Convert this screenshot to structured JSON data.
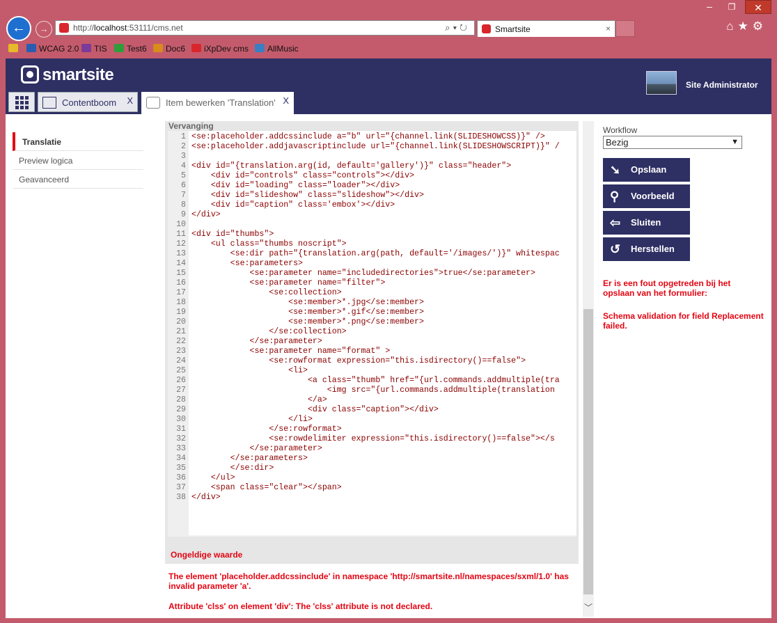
{
  "browser": {
    "address_prefix": "http://",
    "address_host": "localhost",
    "address_rest": ":53111/cms.net",
    "tab_title": "Smartsite",
    "tab_close": "×",
    "favorites": [
      {
        "label": "WCAG 2.0",
        "icon": "w3c-icon",
        "color": "#2a5db0"
      },
      {
        "label": "TIS",
        "icon": "tis-icon",
        "color": "#7a3b99"
      },
      {
        "label": "Test6",
        "icon": "check-icon",
        "color": "#2e9d3a"
      },
      {
        "label": "Doc6",
        "icon": "doc-icon",
        "color": "#d98b1b"
      },
      {
        "label": "iXpDev cms",
        "icon": "smartsite-icon",
        "color": "#d9262c"
      },
      {
        "label": "AllMusic",
        "icon": "allmusic-icon",
        "color": "#3a7fc4"
      }
    ]
  },
  "app": {
    "logo_text": "smartsite",
    "user_name": "Site Administrator",
    "tabs": [
      {
        "label": "Contentboom",
        "close": "X"
      },
      {
        "label": "Item bewerken 'Translation'",
        "close": "X"
      }
    ]
  },
  "leftnav": {
    "items": [
      "Translatie",
      "Preview logica",
      "Geavanceerd"
    ]
  },
  "editor": {
    "label": "Vervanging",
    "invalid_label": "Ongeldige waarde",
    "lines": [
      {
        "n": "1",
        "text": "<se:placeholder.addcssinclude a=\"b\" url=\"{channel.link(SLIDESHOWCSS)}\" />"
      },
      {
        "n": "2",
        "text": "<se:placeholder.addjavascriptinclude url=\"{channel.link(SLIDESHOWSCRIPT)}\" /"
      },
      {
        "n": "3",
        "text": ""
      },
      {
        "n": "4",
        "text": "<div id=\"{translation.arg(id, default='gallery')}\" class=\"header\">"
      },
      {
        "n": "5",
        "text": "    <div id=\"controls\" class=\"controls\"></div>"
      },
      {
        "n": "6",
        "text": "    <div id=\"loading\" class=\"loader\"></div>"
      },
      {
        "n": "7",
        "text": "    <div id=\"slideshow\" class=\"slideshow\"></div>"
      },
      {
        "n": "8",
        "text": "    <div id=\"caption\" class='embox'></div>"
      },
      {
        "n": "9",
        "text": "</div>"
      },
      {
        "n": "10",
        "text": ""
      },
      {
        "n": "11",
        "text": "<div id=\"thumbs\">"
      },
      {
        "n": "12",
        "text": "    <ul class=\"thumbs noscript\">"
      },
      {
        "n": "13",
        "text": "        <se:dir path=\"{translation.arg(path, default='/images/')}\" whitespac"
      },
      {
        "n": "14",
        "text": "        <se:parameters>"
      },
      {
        "n": "15",
        "text": "            <se:parameter name=\"includedirectories\">true</se:parameter>"
      },
      {
        "n": "16",
        "text": "            <se:parameter name=\"filter\">"
      },
      {
        "n": "17",
        "text": "                <se:collection>"
      },
      {
        "n": "18",
        "text": "                    <se:member>*.jpg</se:member>"
      },
      {
        "n": "19",
        "text": "                    <se:member>*.gif</se:member>"
      },
      {
        "n": "20",
        "text": "                    <se:member>*.png</se:member>"
      },
      {
        "n": "21",
        "text": "                </se:collection>"
      },
      {
        "n": "22",
        "text": "            </se:parameter>"
      },
      {
        "n": "23",
        "text": "            <se:parameter name=\"format\" >"
      },
      {
        "n": "24",
        "text": "                <se:rowformat expression=\"this.isdirectory()==false\">"
      },
      {
        "n": "25",
        "text": "                    <li>"
      },
      {
        "n": "26",
        "text": "                        <a class=\"thumb\" href=\"{url.commands.addmultiple(tra"
      },
      {
        "n": "27",
        "text": "                            <img src=\"{url.commands.addmultiple(translation"
      },
      {
        "n": "28",
        "text": "                        </a>"
      },
      {
        "n": "29",
        "text": "                        <div class=\"caption\"></div>"
      },
      {
        "n": "30",
        "text": "                    </li>"
      },
      {
        "n": "31",
        "text": "                </se:rowformat>"
      },
      {
        "n": "32",
        "text": "                <se:rowdelimiter expression=\"this.isdirectory()==false\"></s"
      },
      {
        "n": "33",
        "text": "            </se:parameter>"
      },
      {
        "n": "34",
        "text": "        </se:parameters>"
      },
      {
        "n": "35",
        "text": "        </se:dir>"
      },
      {
        "n": "36",
        "text": "    </ul>"
      },
      {
        "n": "37",
        "text": "    <span class=\"clear\"></span>"
      },
      {
        "n": "38",
        "text": "</div>"
      }
    ]
  },
  "errors": {
    "error1_line1": "The element 'placeholder.addcssinclude' in namespace 'http://smartsite.nl/namespaces/sxml/1.0' has",
    "error1_line2": "invalid parameter 'a'.",
    "error2": "Attribute 'clss' on element 'div': The 'clss' attribute is not declared."
  },
  "sidebar": {
    "workflow_label": "Workflow",
    "workflow_value": "Bezig",
    "buttons": [
      {
        "label": "Opslaan",
        "icon": "save-arrow-icon"
      },
      {
        "label": "Voorbeeld",
        "icon": "search-icon"
      },
      {
        "label": "Sluiten",
        "icon": "close-arrow-icon"
      },
      {
        "label": "Herstellen",
        "icon": "restore-icon"
      }
    ],
    "error_line1": "Er is een fout opgetreden bij het",
    "error_line2": "opslaan van het formulier:",
    "error_line3": "Schema validation for field Replacement",
    "error_line4": "failed."
  },
  "colors": {
    "accent": "#2e2f63",
    "error": "#e30613",
    "chrome": "#c45b6c"
  }
}
